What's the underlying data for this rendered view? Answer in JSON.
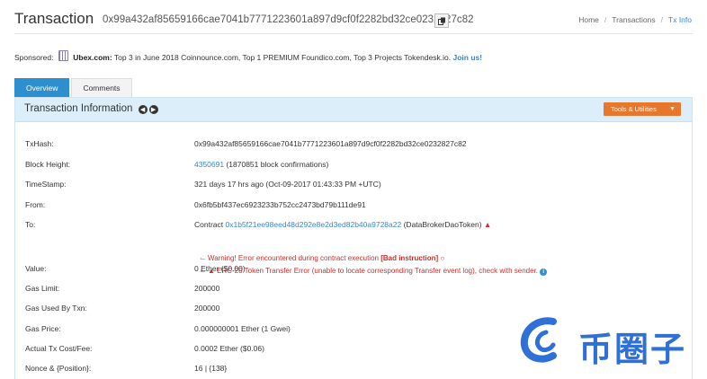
{
  "header": {
    "title": "Transaction",
    "hash": "0x99a432af85659166cae7041b7771223601a897d9cf0f2282bd32ce0232827c82",
    "breadcrumb": [
      "Home",
      "Transactions",
      "Tx Info"
    ]
  },
  "sponsored": {
    "label": "Sponsored:",
    "brand": "Ubex.com:",
    "text": "Top 3 in June 2018 Coinnounce.com, Top 1 PREMIUM Foundico.com, Top 3 Projects Tokendesk.io.",
    "link": "Join us!"
  },
  "tabs": [
    "Overview",
    "Comments"
  ],
  "panel": {
    "title": "Transaction Information",
    "tools_label": "Tools & Utilities"
  },
  "details": {
    "txhash": {
      "label": "TxHash:",
      "value": "0x99a432af85659166cae7041b7771223601a897d9cf0f2282bd32ce0232827c82"
    },
    "block": {
      "label": "Block Height:",
      "link": "4350691",
      "value": "(1870851 block confirmations)"
    },
    "timestamp": {
      "label": "TimeStamp:",
      "value": "321 days 17 hrs ago (Oct-09-2017 01:43:33 PM +UTC)"
    },
    "from": {
      "label": "From:",
      "value": "0x6fb5bf437ec6923233b752cc2473bd79b111de91"
    },
    "to": {
      "label": "To:",
      "prefix": "Contract",
      "address": "0x1b5f21ee98eed48d292e8e2d3ed82b40a9728a22",
      "name": "(DataBrokerDaoToken)",
      "warning1_pre": "Warning! Error encountered during contract execution",
      "warning1_bold": "[Bad instruction]",
      "warning2": "ERC-20 Token Transfer Error (unable to locate corresponding Transfer event log), check with sender."
    },
    "value": {
      "label": "Value:",
      "value": "0 Ether ($0.00)"
    },
    "gas_limit": {
      "label": "Gas Limit:",
      "value": "200000"
    },
    "gas_used": {
      "label": "Gas Used By Txn:",
      "value": "200000"
    },
    "gas_price": {
      "label": "Gas Price:",
      "value": "0.000000001 Ether (1 Gwei)"
    },
    "cost": {
      "label": "Actual Tx Cost/Fee:",
      "value": "0.0002 Ether ($0.06)"
    },
    "nonce": {
      "label": "Nonce & {Position}:",
      "value": "16 | {138}"
    }
  },
  "watermark": {
    "text": "币圈子",
    "color": "#2f6fd8"
  },
  "colors": {
    "accent": "#2d8fd0",
    "tools": "#e8772e",
    "warning": "#c9302c",
    "link": "#3a86c8"
  }
}
